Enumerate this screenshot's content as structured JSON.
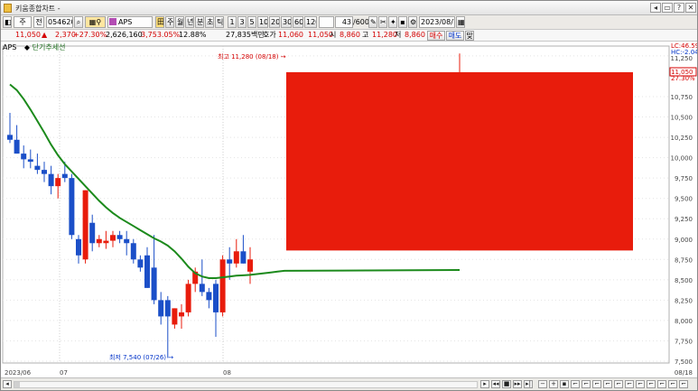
{
  "window": {
    "title": "키움종합차트 -",
    "buttons": [
      "◂",
      "▭",
      "?",
      "✕"
    ]
  },
  "toolbar": {
    "market_type": "주",
    "period_label": "전",
    "stock_code": "054620",
    "stock_name": "APS",
    "period_buttons": [
      "주",
      "월",
      "년",
      "분",
      "초",
      "틱"
    ],
    "interval_buttons": [
      "1",
      "3",
      "5",
      "10",
      "20",
      "30",
      "60",
      "120"
    ],
    "count_value": "43",
    "count_total": "/600",
    "date": "2023/08/18"
  },
  "quote": {
    "price": "11,050",
    "change_arrow": "▲",
    "change": "2,370",
    "change_pct": "+27.30%",
    "volume": "2,626,160",
    "volume_pct": "3,753.05%",
    "turnover_rate": "12.88%",
    "amount": "27,835백만",
    "ask_label": "호가",
    "ask": "11,060",
    "bid": "11,050",
    "open_label": "시",
    "open": "8,860",
    "high_label": "고",
    "high": "11,280",
    "low_label": "저",
    "low": "8,860",
    "buy_button": "매수",
    "sell_button": "매도",
    "extra_button": "맞"
  },
  "legend": {
    "stock": "APS",
    "indicator": "단기추세선",
    "indicator_color": "#1c8a1c"
  },
  "chart_data": {
    "type": "candlestick",
    "up_color": "#e81c0c",
    "down_color": "#1b4fc8",
    "trend_color": "#1c8a1c",
    "ylim": [
      7500,
      11200
    ],
    "y_ticks": [
      "11,250",
      "10,750",
      "10,500",
      "10,250",
      "10,000",
      "9,750",
      "9,500",
      "9,250",
      "9,000",
      "8,750",
      "8,500",
      "8,250",
      "8,000",
      "7,750",
      "7,500"
    ],
    "x_ticks": [
      "2023/06",
      "07",
      "08",
      "08/18"
    ],
    "high_annotation": "최고 11,280 (08/18)",
    "low_annotation": "최저 7,540 (07/26)",
    "price_tags": [
      {
        "text": "LC:46.59",
        "color": "#d40000"
      },
      {
        "text": "HC:-2.04",
        "color": "#0032c8"
      },
      {
        "text": "11,050",
        "color": "#d40000"
      },
      {
        "text": "27.30%",
        "color": "#d40000"
      }
    ],
    "candles": [
      {
        "o": 10280,
        "h": 10550,
        "l": 10180,
        "c": 10220
      },
      {
        "o": 10220,
        "h": 10400,
        "l": 10050,
        "c": 10050
      },
      {
        "o": 10050,
        "h": 10150,
        "l": 9870,
        "c": 9980
      },
      {
        "o": 9980,
        "h": 10100,
        "l": 9870,
        "c": 9950
      },
      {
        "o": 9900,
        "h": 10050,
        "l": 9800,
        "c": 9850
      },
      {
        "o": 9850,
        "h": 9950,
        "l": 9700,
        "c": 9800
      },
      {
        "o": 9800,
        "h": 9900,
        "l": 9550,
        "c": 9650
      },
      {
        "o": 9650,
        "h": 9800,
        "l": 9500,
        "c": 9750
      },
      {
        "o": 9800,
        "h": 9950,
        "l": 9700,
        "c": 9750
      },
      {
        "o": 9750,
        "h": 9800,
        "l": 9000,
        "c": 9050
      },
      {
        "o": 9000,
        "h": 9050,
        "l": 8700,
        "c": 8800
      },
      {
        "o": 8750,
        "h": 9600,
        "l": 8700,
        "c": 9600
      },
      {
        "o": 9200,
        "h": 9300,
        "l": 8850,
        "c": 8950
      },
      {
        "o": 8950,
        "h": 9050,
        "l": 8900,
        "c": 9000
      },
      {
        "o": 8950,
        "h": 9100,
        "l": 8880,
        "c": 8980
      },
      {
        "o": 8980,
        "h": 9100,
        "l": 8900,
        "c": 9050
      },
      {
        "o": 9050,
        "h": 9100,
        "l": 8950,
        "c": 9000
      },
      {
        "o": 9000,
        "h": 9100,
        "l": 8800,
        "c": 8950
      },
      {
        "o": 8950,
        "h": 9000,
        "l": 8700,
        "c": 8750
      },
      {
        "o": 8750,
        "h": 8800,
        "l": 8600,
        "c": 8650
      },
      {
        "o": 8800,
        "h": 8900,
        "l": 8400,
        "c": 8400
      },
      {
        "o": 8650,
        "h": 9050,
        "l": 8200,
        "c": 8250
      },
      {
        "o": 8250,
        "h": 8350,
        "l": 7950,
        "c": 8050
      },
      {
        "o": 8250,
        "h": 8300,
        "l": 7540,
        "c": 8050
      },
      {
        "o": 7950,
        "h": 8150,
        "l": 7900,
        "c": 8150
      },
      {
        "o": 8050,
        "h": 8200,
        "l": 7900,
        "c": 8100
      },
      {
        "o": 8100,
        "h": 8500,
        "l": 8050,
        "c": 8450
      },
      {
        "o": 8450,
        "h": 8650,
        "l": 8350,
        "c": 8600
      },
      {
        "o": 8450,
        "h": 8750,
        "l": 8300,
        "c": 8350
      },
      {
        "o": 8350,
        "h": 8400,
        "l": 8150,
        "c": 8250
      },
      {
        "o": 8450,
        "h": 8500,
        "l": 7800,
        "c": 8100
      },
      {
        "o": 8100,
        "h": 8800,
        "l": 8050,
        "c": 8750
      },
      {
        "o": 8750,
        "h": 8900,
        "l": 8500,
        "c": 8700
      },
      {
        "o": 8700,
        "h": 9000,
        "l": 8650,
        "c": 8850
      },
      {
        "o": 8850,
        "h": 9050,
        "l": 8700,
        "c": 8700
      },
      {
        "o": 8600,
        "h": 8900,
        "l": 8450,
        "c": 8750
      },
      {
        "o": 8860,
        "h": 11280,
        "l": 8860,
        "c": 11050
      }
    ],
    "trend_line": [
      10900,
      10830,
      10720,
      10590,
      10450,
      10310,
      10160,
      10030,
      9920,
      9830,
      9740,
      9650,
      9560,
      9470,
      9390,
      9320,
      9260,
      9210,
      9160,
      9110,
      9060,
      9010,
      8970,
      8920,
      8850,
      8760,
      8660,
      8580,
      8540,
      8520,
      8520,
      8530,
      8540,
      8550,
      8555,
      8560,
      8570,
      8580,
      8590,
      8600,
      8610,
      8620
    ]
  }
}
